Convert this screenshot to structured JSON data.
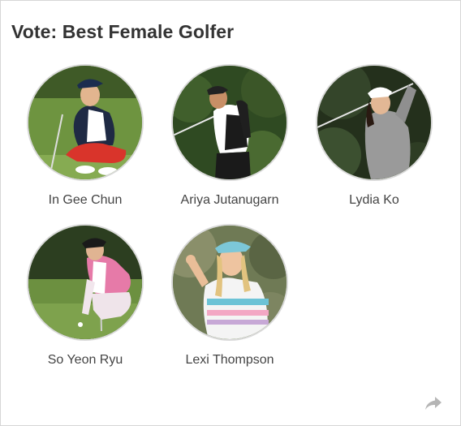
{
  "poll": {
    "title": "Vote: Best Female Golfer",
    "options": [
      {
        "name": "In Gee Chun"
      },
      {
        "name": "Ariya Jutanugarn"
      },
      {
        "name": "Lydia Ko"
      },
      {
        "name": "So Yeon Ryu"
      },
      {
        "name": "Lexi Thompson"
      }
    ]
  },
  "icons": {
    "share": "share-arrow-icon"
  },
  "colors": {
    "title": "#333333",
    "name": "#444444",
    "border": "#d6d6d6",
    "share": "#b5b5b5"
  }
}
